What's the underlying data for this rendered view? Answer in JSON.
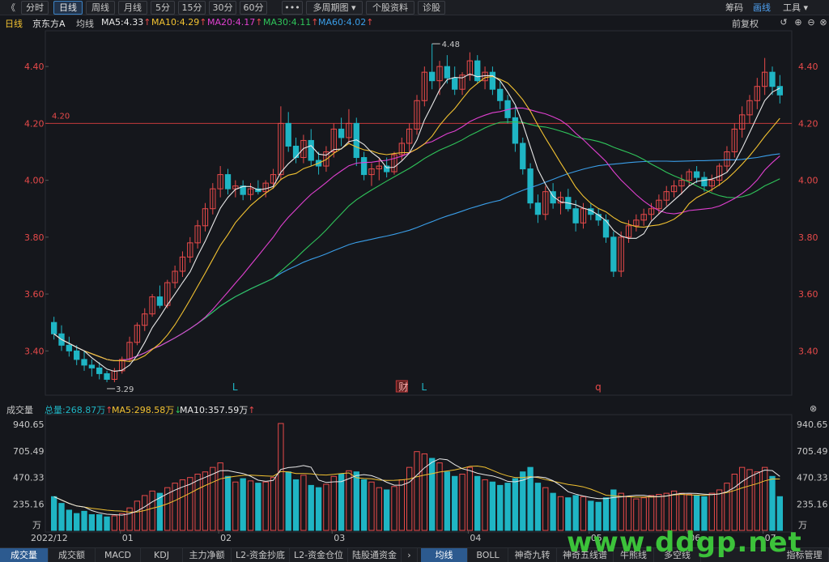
{
  "toolbar": {
    "back": "《",
    "tabs": [
      {
        "label": "分时",
        "active": false
      },
      {
        "label": "日线",
        "active": true
      },
      {
        "label": "周线",
        "active": false
      },
      {
        "label": "月线",
        "active": false
      },
      {
        "label": "5分",
        "active": false
      },
      {
        "label": "15分",
        "active": false
      },
      {
        "label": "30分",
        "active": false
      },
      {
        "label": "60分",
        "active": false
      },
      {
        "label": "•••",
        "active": false
      },
      {
        "label": "多周期图 ▾",
        "active": false
      },
      {
        "label": "个股资料",
        "active": false
      },
      {
        "label": "诊股",
        "active": false
      }
    ],
    "right": [
      {
        "label": "筹码",
        "active": false
      },
      {
        "label": "画线",
        "active": true
      },
      {
        "label": "工具 ▾",
        "active": false
      }
    ]
  },
  "ma_header": {
    "period": "日线",
    "stock": "京东方A",
    "mode": "均线",
    "items": [
      {
        "text": "MA5:4.33",
        "arrow": "↑",
        "color": "#e8e8e8"
      },
      {
        "text": "MA10:4.29",
        "arrow": "↑",
        "color": "#f2c231"
      },
      {
        "text": "MA20:4.17",
        "arrow": "↑",
        "color": "#e040d0"
      },
      {
        "text": "MA30:4.11",
        "arrow": "↑",
        "color": "#2fc45a"
      },
      {
        "text": "MA60:4.02",
        "arrow": "↑",
        "color": "#3a9ee8"
      }
    ],
    "adjust": "前复权"
  },
  "chart_data": [
    {
      "type": "candlestick",
      "y_axis": {
        "ticks": [
          "4.40",
          "4.20",
          "4.00",
          "3.80",
          "3.60",
          "3.40"
        ],
        "range": [
          3.25,
          4.52
        ]
      },
      "reference_line": {
        "value": 4.2,
        "label": "4.20"
      },
      "annotations": [
        {
          "label": "4.48",
          "kind": "high",
          "date": "04"
        },
        {
          "label": "3.29",
          "kind": "low",
          "date": "2022/12"
        }
      ],
      "event_markers": [
        "L",
        "财",
        "L",
        "q"
      ],
      "x_labels": [
        "2022/12",
        "01",
        "02",
        "03",
        "04",
        "05",
        "06",
        "07"
      ],
      "ohlc": [
        [
          3.5,
          3.52,
          3.44,
          3.46
        ],
        [
          3.46,
          3.49,
          3.4,
          3.42
        ],
        [
          3.42,
          3.45,
          3.38,
          3.4
        ],
        [
          3.4,
          3.42,
          3.35,
          3.37
        ],
        [
          3.37,
          3.4,
          3.33,
          3.35
        ],
        [
          3.35,
          3.37,
          3.31,
          3.34
        ],
        [
          3.34,
          3.36,
          3.3,
          3.32
        ],
        [
          3.32,
          3.33,
          3.29,
          3.3
        ],
        [
          3.3,
          3.34,
          3.29,
          3.33
        ],
        [
          3.33,
          3.38,
          3.32,
          3.37
        ],
        [
          3.37,
          3.45,
          3.36,
          3.43
        ],
        [
          3.43,
          3.5,
          3.42,
          3.49
        ],
        [
          3.49,
          3.55,
          3.47,
          3.53
        ],
        [
          3.53,
          3.6,
          3.52,
          3.59
        ],
        [
          3.59,
          3.63,
          3.55,
          3.56
        ],
        [
          3.56,
          3.65,
          3.55,
          3.64
        ],
        [
          3.64,
          3.7,
          3.62,
          3.68
        ],
        [
          3.68,
          3.75,
          3.66,
          3.73
        ],
        [
          3.73,
          3.8,
          3.71,
          3.78
        ],
        [
          3.78,
          3.86,
          3.76,
          3.84
        ],
        [
          3.84,
          3.92,
          3.82,
          3.9
        ],
        [
          3.9,
          3.99,
          3.88,
          3.97
        ],
        [
          3.97,
          4.05,
          3.94,
          4.02
        ],
        [
          4.02,
          4.04,
          3.95,
          3.97
        ],
        [
          3.97,
          4.0,
          3.94,
          3.98
        ],
        [
          3.98,
          4.0,
          3.93,
          3.95
        ],
        [
          3.95,
          3.99,
          3.93,
          3.97
        ],
        [
          3.97,
          4.0,
          3.95,
          3.96
        ],
        [
          3.96,
          4.0,
          3.94,
          3.99
        ],
        [
          3.99,
          4.04,
          3.97,
          4.02
        ],
        [
          4.02,
          4.26,
          4.0,
          4.2
        ],
        [
          4.2,
          4.24,
          4.1,
          4.12
        ],
        [
          4.12,
          4.15,
          4.06,
          4.08
        ],
        [
          4.08,
          4.16,
          4.06,
          4.14
        ],
        [
          4.14,
          4.18,
          4.05,
          4.07
        ],
        [
          4.07,
          4.1,
          4.02,
          4.05
        ],
        [
          4.05,
          4.12,
          4.03,
          4.1
        ],
        [
          4.1,
          4.2,
          4.08,
          4.18
        ],
        [
          4.18,
          4.22,
          4.12,
          4.15
        ],
        [
          4.15,
          4.25,
          4.13,
          4.2
        ],
        [
          4.2,
          4.22,
          4.05,
          4.08
        ],
        [
          4.08,
          4.1,
          4.0,
          4.02
        ],
        [
          4.02,
          4.06,
          3.98,
          4.04
        ],
        [
          4.04,
          4.08,
          4.0,
          4.05
        ],
        [
          4.05,
          4.08,
          4.01,
          4.03
        ],
        [
          4.03,
          4.1,
          4.02,
          4.09
        ],
        [
          4.09,
          4.15,
          4.07,
          4.13
        ],
        [
          4.13,
          4.2,
          4.1,
          4.18
        ],
        [
          4.18,
          4.3,
          4.16,
          4.28
        ],
        [
          4.28,
          4.4,
          4.26,
          4.38
        ],
        [
          4.38,
          4.48,
          4.32,
          4.35
        ],
        [
          4.35,
          4.42,
          4.3,
          4.4
        ],
        [
          4.4,
          4.44,
          4.34,
          4.36
        ],
        [
          4.36,
          4.4,
          4.3,
          4.32
        ],
        [
          4.32,
          4.38,
          4.3,
          4.37
        ],
        [
          4.37,
          4.45,
          4.35,
          4.42
        ],
        [
          4.42,
          4.44,
          4.34,
          4.35
        ],
        [
          4.35,
          4.4,
          4.32,
          4.38
        ],
        [
          4.38,
          4.4,
          4.3,
          4.32
        ],
        [
          4.32,
          4.35,
          4.25,
          4.28
        ],
        [
          4.28,
          4.3,
          4.2,
          4.22
        ],
        [
          4.22,
          4.26,
          4.1,
          4.13
        ],
        [
          4.13,
          4.15,
          4.02,
          4.04
        ],
        [
          4.04,
          4.06,
          3.9,
          3.92
        ],
        [
          3.92,
          3.95,
          3.85,
          3.88
        ],
        [
          3.88,
          3.98,
          3.86,
          3.96
        ],
        [
          3.96,
          3.99,
          3.9,
          3.92
        ],
        [
          3.92,
          3.96,
          3.88,
          3.94
        ],
        [
          3.94,
          3.97,
          3.89,
          3.9
        ],
        [
          3.9,
          3.93,
          3.82,
          3.85
        ],
        [
          3.85,
          3.92,
          3.83,
          3.9
        ],
        [
          3.9,
          3.92,
          3.86,
          3.88
        ],
        [
          3.88,
          3.9,
          3.84,
          3.86
        ],
        [
          3.86,
          3.88,
          3.78,
          3.8
        ],
        [
          3.8,
          3.82,
          3.66,
          3.68
        ],
        [
          3.68,
          3.82,
          3.66,
          3.8
        ],
        [
          3.8,
          3.86,
          3.78,
          3.84
        ],
        [
          3.84,
          3.88,
          3.82,
          3.86
        ],
        [
          3.86,
          3.9,
          3.84,
          3.88
        ],
        [
          3.88,
          3.92,
          3.86,
          3.9
        ],
        [
          3.9,
          3.95,
          3.88,
          3.93
        ],
        [
          3.93,
          3.98,
          3.91,
          3.96
        ],
        [
          3.96,
          4.0,
          3.94,
          3.98
        ],
        [
          3.98,
          4.02,
          3.95,
          4.0
        ],
        [
          4.0,
          4.04,
          3.98,
          4.03
        ],
        [
          4.03,
          4.05,
          3.99,
          4.01
        ],
        [
          4.01,
          4.03,
          3.96,
          3.98
        ],
        [
          3.98,
          4.02,
          3.96,
          4.0
        ],
        [
          4.0,
          4.06,
          3.98,
          4.05
        ],
        [
          4.05,
          4.12,
          4.03,
          4.1
        ],
        [
          4.1,
          4.2,
          4.08,
          4.18
        ],
        [
          4.18,
          4.26,
          4.15,
          4.23
        ],
        [
          4.23,
          4.3,
          4.2,
          4.28
        ],
        [
          4.28,
          4.36,
          4.25,
          4.33
        ],
        [
          4.33,
          4.43,
          4.3,
          4.38
        ],
        [
          4.38,
          4.4,
          4.3,
          4.33
        ],
        [
          4.33,
          4.37,
          4.27,
          4.3
        ]
      ]
    },
    {
      "type": "bar",
      "title": "成交量",
      "summary": [
        {
          "text": "总量:268.87万",
          "arrow": "↑",
          "color": "#1fb5c4"
        },
        {
          "text": "MA5:298.58万",
          "arrow": "↓",
          "color": "#f2c231"
        },
        {
          "text": "MA10:357.59万",
          "arrow": "↑",
          "color": "#e8e8e8"
        }
      ],
      "y_axis": {
        "ticks": [
          "940.65",
          "705.49",
          "470.33",
          "235.16"
        ],
        "unit": "万",
        "range": [
          0,
          1000
        ]
      },
      "values": [
        300,
        240,
        180,
        150,
        170,
        140,
        140,
        120,
        130,
        150,
        200,
        260,
        310,
        350,
        330,
        380,
        420,
        450,
        470,
        500,
        520,
        560,
        600,
        480,
        430,
        460,
        440,
        420,
        430,
        470,
        950,
        520,
        450,
        490,
        400,
        380,
        410,
        480,
        500,
        530,
        520,
        450,
        430,
        380,
        360,
        390,
        450,
        560,
        700,
        680,
        640,
        600,
        520,
        480,
        500,
        560,
        480,
        450,
        430,
        400,
        420,
        460,
        520,
        560,
        420,
        380,
        330,
        300,
        290,
        310,
        300,
        260,
        250,
        290,
        360,
        330,
        300,
        280,
        290,
        310,
        320,
        330,
        350,
        330,
        320,
        310,
        300,
        330,
        360,
        420,
        500,
        560,
        540,
        520,
        560,
        480,
        300
      ]
    }
  ],
  "close_icon": "⊗",
  "bottom_tabs_left": [
    {
      "label": "成交量",
      "active": true
    },
    {
      "label": "成交额",
      "active": false
    },
    {
      "label": "MACD",
      "active": false
    },
    {
      "label": "KDJ",
      "active": false
    },
    {
      "label": "主力净额",
      "active": false
    },
    {
      "label": "L2-资金抄底",
      "active": false
    },
    {
      "label": "L2-资金仓位",
      "active": false
    },
    {
      "label": "陆股通资金",
      "active": false
    },
    {
      "label": "›",
      "active": false
    }
  ],
  "bottom_tabs_right": [
    {
      "label": "均线",
      "active": true
    },
    {
      "label": "BOLL",
      "active": false
    },
    {
      "label": "神奇九转",
      "active": false
    },
    {
      "label": "神奇五线谱",
      "active": false
    },
    {
      "label": "牛熊线",
      "active": false
    },
    {
      "label": "多空线",
      "active": false
    },
    {
      "label": "指标管理",
      "active": false
    }
  ],
  "watermark": "www.ddgp.net",
  "colors": {
    "up": "#e84a4a",
    "down": "#1fb5c4",
    "ma5": "#e8e8e8",
    "ma10": "#f2c231",
    "ma20": "#e040d0",
    "ma30": "#2fc45a",
    "ma60": "#3a9ee8",
    "axis_label": "#e84a4a"
  }
}
